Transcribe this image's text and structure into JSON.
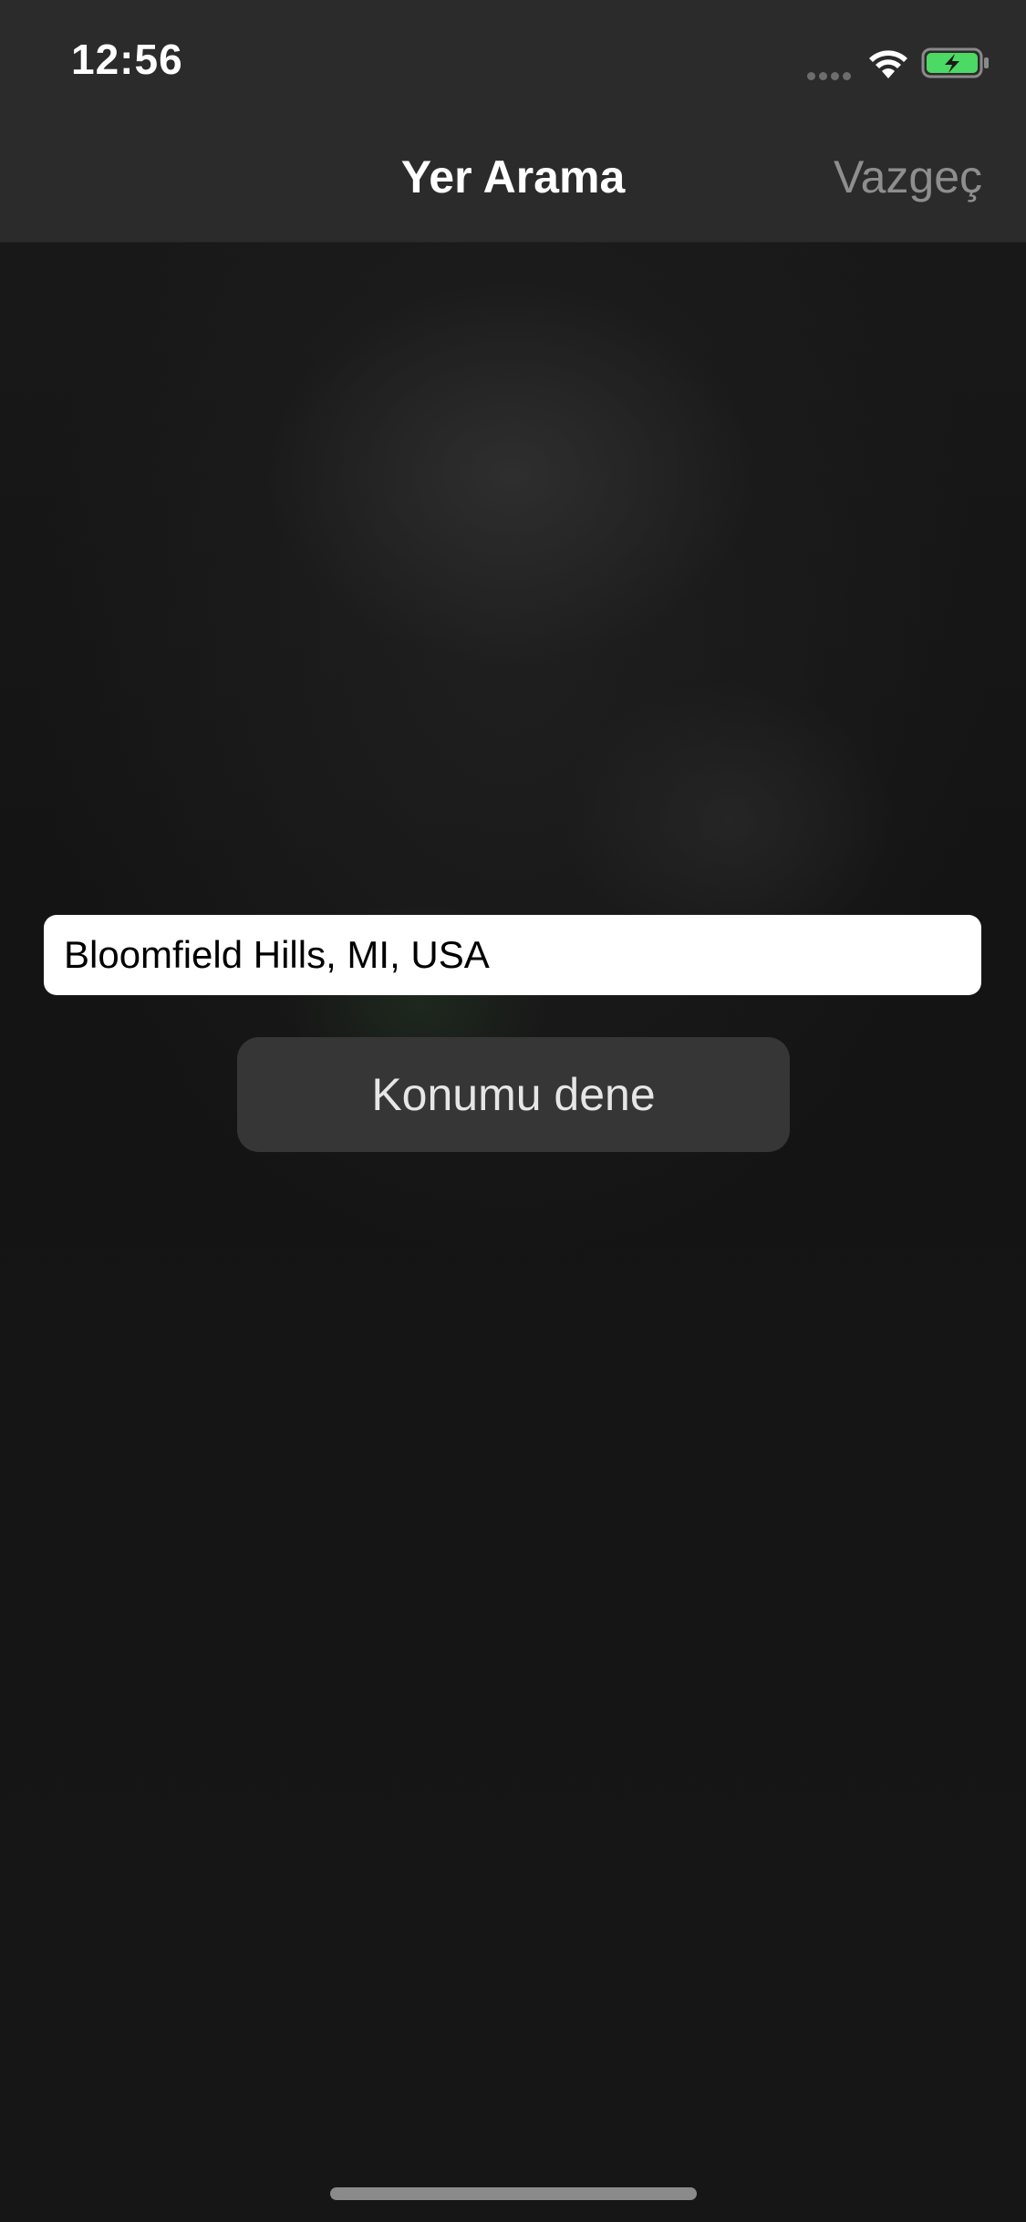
{
  "status_bar": {
    "time": "12:56",
    "icons": [
      "signal-dots-icon",
      "wifi-icon",
      "battery-charging-icon"
    ],
    "battery_color": "#4cd964"
  },
  "nav": {
    "title": "Yer Arama",
    "cancel_label": "Vazgeç"
  },
  "search": {
    "value": "Bloomfield Hills, MI, USA",
    "placeholder": ""
  },
  "actions": {
    "try_location_label": "Konumu dene"
  },
  "colors": {
    "background": "#151515",
    "bar": "#2b2b2b",
    "button": "#363636",
    "cancel_text": "#8e8e8e"
  }
}
